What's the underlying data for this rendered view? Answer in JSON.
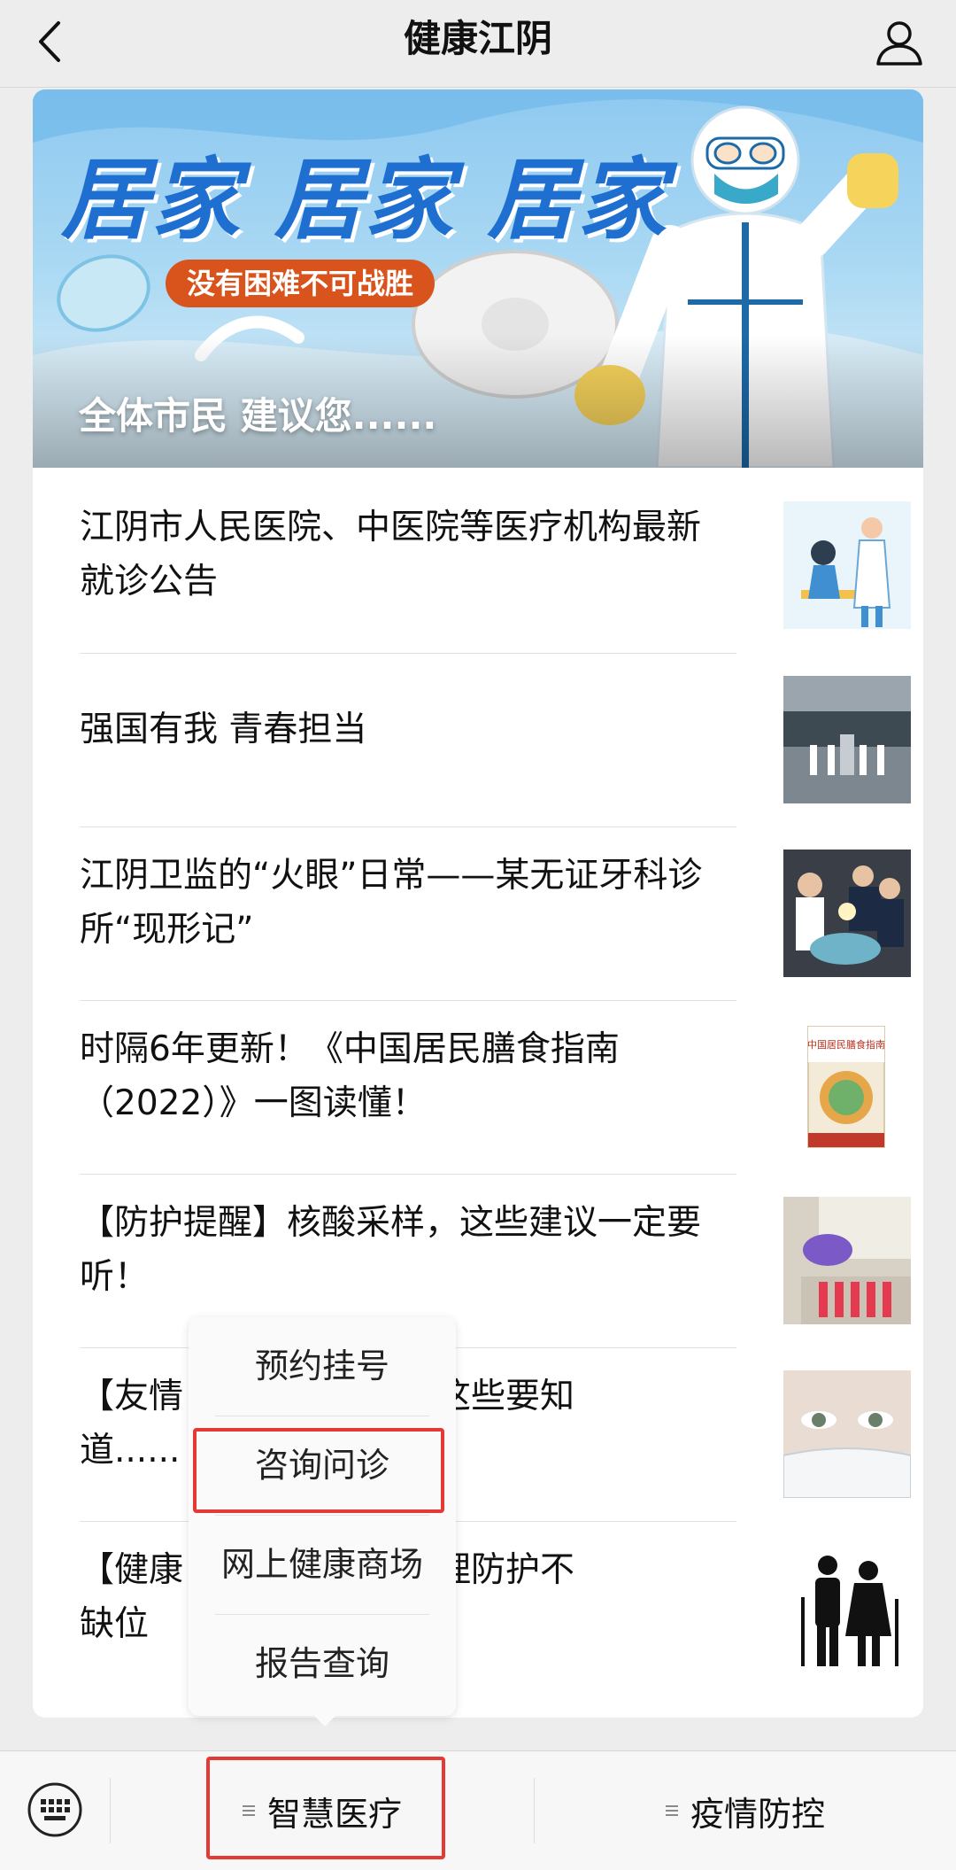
{
  "nav": {
    "title": "健康江阴",
    "back_icon": "chevron-left-icon",
    "profile_icon": "user-icon"
  },
  "banner": {
    "headline": "居家 居家 居家",
    "pill": "没有困难不可战胜",
    "caption": "全体市民 建议您......"
  },
  "articles": [
    {
      "title": "江阴市人民医院、中医院等医疗机构最新就诊公告",
      "thumb": "vaccination-illustration"
    },
    {
      "title": "强国有我 青春担当",
      "thumb": "group-photo"
    },
    {
      "title": "江阴卫监的“火眼”日常——某无证牙科诊所“现形记”",
      "thumb": "dental-inspection-photo"
    },
    {
      "title": "时隔6年更新！《中国居民膳食指南（2022）》一图读懂！",
      "thumb": "book-cover",
      "thumb_text": "中国居民膳食指南"
    },
    {
      "title": "【防护提醒】核酸采样，这些建议一定要听！",
      "thumb": "sampling-photo"
    },
    {
      "title": "【友情提醒】正确佩戴口罩，这些要知道......",
      "visible_a": "【友情",
      "visible_b": "罩，这些要知",
      "visible_c": "道......",
      "thumb": "masked-face-photo"
    },
    {
      "title": "【健康】心理防护不缺位",
      "visible_a": "【健康",
      "visible_b": "，心理防护不",
      "visible_c": "缺位",
      "thumb": "elderly-couple-icon"
    }
  ],
  "popup_menu": {
    "items": [
      "预约挂号",
      "咨询问诊",
      "网上健康商场",
      "报告查询"
    ],
    "highlighted": "咨询问诊"
  },
  "bottom_bar": {
    "keyboard_icon": "keyboard-icon",
    "menus": [
      "智慧医疗",
      "疫情防控"
    ],
    "highlighted": "智慧医疗"
  },
  "colors": {
    "highlight": "#e53935",
    "banner_headline": "#1f6fd1",
    "pill": "#d9541d"
  }
}
